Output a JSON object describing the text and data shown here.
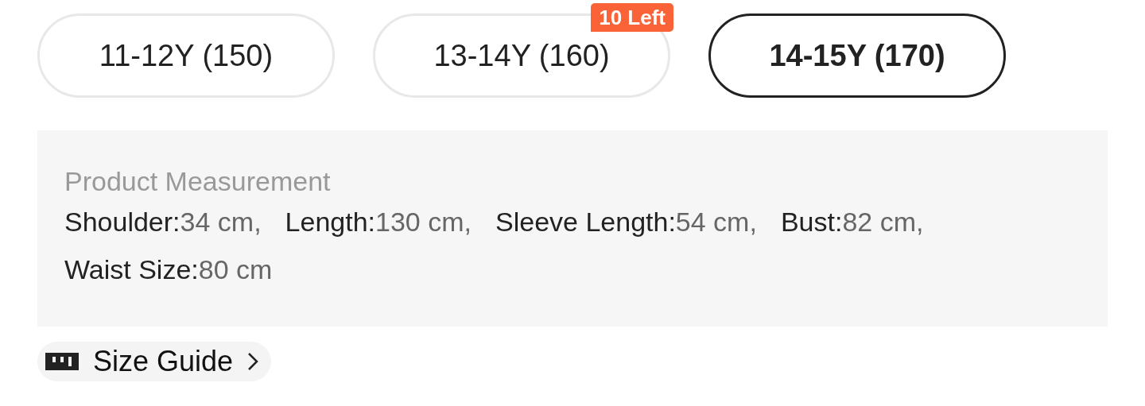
{
  "sizes": [
    {
      "label": "11-12Y (150)",
      "selected": false
    },
    {
      "label": "13-14Y (160)",
      "selected": false,
      "badge": "10 Left"
    },
    {
      "label": "14-15Y (170)",
      "selected": true
    }
  ],
  "measurement": {
    "title": "Product Measurement",
    "items": [
      {
        "label": "Shoulder:",
        "value": "34 cm,"
      },
      {
        "label": "Length:",
        "value": "130 cm,"
      },
      {
        "label": "Sleeve Length:",
        "value": "54 cm,"
      },
      {
        "label": "Bust:",
        "value": "82 cm,"
      },
      {
        "label": "Waist Size:",
        "value": "80 cm"
      }
    ]
  },
  "size_guide": {
    "label": "Size Guide"
  }
}
